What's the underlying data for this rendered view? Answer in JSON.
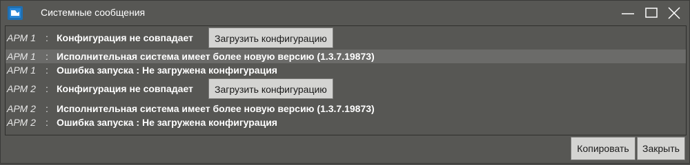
{
  "window": {
    "title": "Системные сообщения",
    "icon": "app-logo-icon"
  },
  "messages": [
    {
      "source": "АРМ 1",
      "separator": ":",
      "text": "Конфигурация не совпадает",
      "action": "Загрузить конфигурацию"
    },
    {
      "source": "АРМ 1",
      "separator": ":",
      "text": "Исполнительная система имеет более новую версию (1.3.7.19873)",
      "selected": true
    },
    {
      "source": "АРМ 1",
      "separator": ":",
      "text": "Ошибка запуска : Не загружена конфигурация"
    },
    {
      "source": "АРМ 2",
      "separator": ":",
      "text": "Конфигурация не совпадает",
      "action": "Загрузить конфигурацию"
    },
    {
      "source": "АРМ 2",
      "separator": ":",
      "text": "Исполнительная система имеет более новую версию (1.3.7.19873)"
    },
    {
      "source": "АРМ 2",
      "separator": ":",
      "text": "Ошибка запуска : Не загружена конфигурация"
    }
  ],
  "footer": {
    "copy_label": "Копировать",
    "close_label": "Закрыть"
  },
  "colors": {
    "background": "#575754",
    "selected_row": "#6b6b69",
    "button_face": "#d4d4d2"
  }
}
